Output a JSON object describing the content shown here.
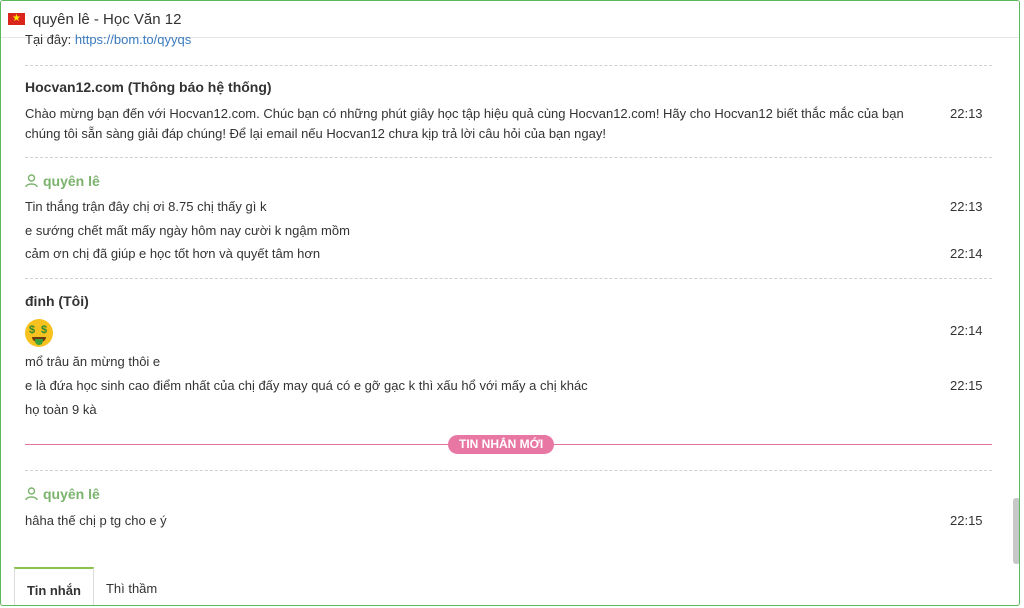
{
  "window": {
    "title": "quyên lê - Học Văn 12"
  },
  "top_link": {
    "prefix": "Tại đây:",
    "url": "https://bom.to/qyyqs"
  },
  "system_message": {
    "sender": "Hocvan12.com (Thông báo hệ thống)",
    "line1": "Chào mừng bạn đến với Hocvan12.com. Chúc bạn có những phút giây học tập hiệu quả cùng Hocvan12.com! Hãy cho Hocvan12 biết thắc mắc của bạn",
    "line2": "chúng tôi sẵn sàng giải đáp chúng! Để lại email nếu Hocvan12 chưa kịp trả lời câu hỏi của bạn ngay!",
    "time": "22:13"
  },
  "group1": {
    "sender": "quyên lê",
    "messages": [
      {
        "text": "Tin thắng trận đây chị ơi 8.75 chị thấy gì k",
        "time": "22:13"
      },
      {
        "text": "e sướng chết mất mấy ngày hôm nay cười k ngậm mồm",
        "time": ""
      },
      {
        "text": "cảm ơn chị đã giúp e học tốt hơn và quyết tâm hơn",
        "time": "22:14"
      }
    ]
  },
  "group2": {
    "sender": "đinh (Tôi)",
    "emoji_time": "22:14",
    "messages": [
      {
        "text": "mổ trâu ăn mừng thôi e",
        "time": ""
      },
      {
        "text": "e là đứa học sinh cao điểm nhất của chị đấy may quá có e gỡ gạc k thì xấu hổ với mấy a chị khác",
        "time": "22:15"
      },
      {
        "text": "họ toàn 9 kà",
        "time": ""
      }
    ]
  },
  "new_messages_label": "TIN NHẮN MỚI",
  "group3": {
    "sender": "quyên lê",
    "messages": [
      {
        "text": "hâha thế chị p tg cho e ý",
        "time": "22:15"
      }
    ]
  },
  "tabs": [
    {
      "label": "Tin nhắn",
      "active": true
    },
    {
      "label": "Thì thầm",
      "active": false
    }
  ],
  "colors": {
    "accent_green": "#7bb36d",
    "new_badge": "#e878a3",
    "link": "#3a7bbf"
  }
}
